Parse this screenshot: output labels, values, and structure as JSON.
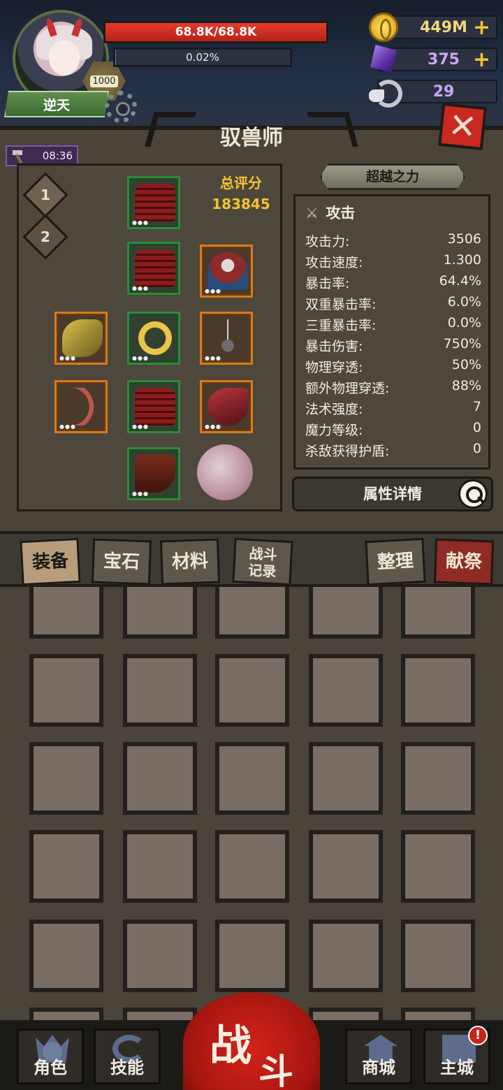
{
  "player": {
    "title": "逆天",
    "level": "1000",
    "hp_text": "68.8K/68.8K",
    "hp_fraction": 1.0,
    "exp_text": "0.02%",
    "exp_fraction": 0.0002
  },
  "resources": {
    "gold": "449M",
    "gems": "375",
    "rams": "29"
  },
  "panel": {
    "title": "驭兽师",
    "timer": "08:36",
    "loadouts": [
      "1",
      "2"
    ],
    "score_label": "总评分",
    "score_value": "183845",
    "transcend_label": "超越之力",
    "detail_label": "属性详情"
  },
  "stats": {
    "header": "攻击",
    "rows": [
      {
        "k": "攻击力:",
        "v": "3506"
      },
      {
        "k": "攻击速度:",
        "v": "1.300"
      },
      {
        "k": "暴击率:",
        "v": "64.4%"
      },
      {
        "k": "双重暴击率:",
        "v": "6.0%"
      },
      {
        "k": "三重暴击率:",
        "v": "0.0%"
      },
      {
        "k": "暴击伤害:",
        "v": "750%"
      },
      {
        "k": "物理穿透:",
        "v": "50%"
      },
      {
        "k": "额外物理穿透:",
        "v": "88%"
      },
      {
        "k": "法术强度:",
        "v": "7"
      },
      {
        "k": "魔力等级:",
        "v": "0"
      },
      {
        "k": "杀敌获得护盾:",
        "v": "0"
      }
    ]
  },
  "tabs": {
    "equip": "装备",
    "gem": "宝石",
    "material": "材料",
    "record_1": "战斗",
    "record_2": "记录",
    "sort": "整理",
    "sacrifice": "献祭"
  },
  "nav": {
    "role": "角色",
    "skill": "技能",
    "battle_1": "战",
    "battle_2": "斗",
    "shop": "商城",
    "city": "主城",
    "city_alert": "!"
  },
  "colors": {
    "hp": "#e53b2e",
    "accent_gold": "#f2c431",
    "rare_green": "#2e8a3a",
    "epic_orange": "#d67a1f",
    "battle_red": "#c8241c"
  }
}
